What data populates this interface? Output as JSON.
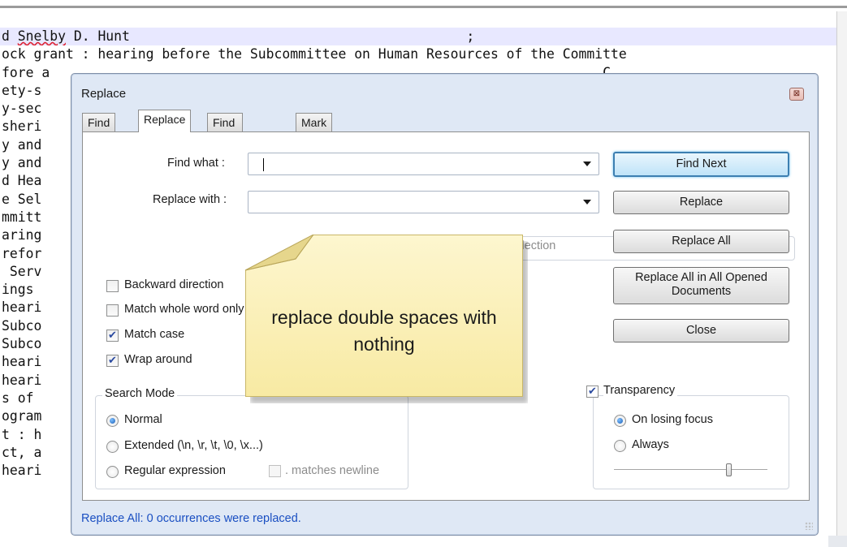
{
  "editor": {
    "lines": [
      "d Snelby D. Hunt                                          ;",
      "ock grant : hearing before the Subcommittee on Human Resources of the Committe",
      "fore a                                                                     C",
      "ety-s                                                                      or",
      "y-sec",
      "sheri                                                                      rc",
      "y and                                                                      or",
      "y and                                                                      or",
      "d Hea                                                                      Hc",
      "e Sel                                                                      s,",
      "mmitt                                                                      nc",
      "aring                                                                      e,",
      "refor                                                                      ur",
      " Serv                                                                      or",
      "ings                                                                       th",
      "heari                                                                      ur",
      "Subco                                                                      s,",
      "Subco                                                                      s,",
      "heari                                                                      ur",
      "heari                                                                      ur",
      "s of                                                                       ir",
      "ogram                                                                      es",
      "t : h                                                                      c",
      "ct, a                                                                      th",
      "heari"
    ],
    "spellcheck_word": "Snelby"
  },
  "dialog": {
    "title": "Replace",
    "close_glyph": "⊠",
    "tabs": [
      {
        "label": "Find",
        "active": false
      },
      {
        "label": "Replace",
        "active": true
      },
      {
        "label": "Find in Files",
        "active": false
      },
      {
        "label": "Mark",
        "active": false
      }
    ],
    "find_what_label": "Find what :",
    "find_what_value": "",
    "replace_with_label": "Replace with :",
    "replace_with_value": "",
    "in_selection_label": "In selection",
    "buttons": {
      "find_next": "Find Next",
      "replace": "Replace",
      "replace_all": "Replace All",
      "replace_all_opened": "Replace All in All Opened Documents",
      "close": "Close"
    },
    "options": [
      {
        "label": "Backward direction",
        "checked": false
      },
      {
        "label": "Match whole word only",
        "checked": false
      },
      {
        "label": "Match case",
        "checked": true
      },
      {
        "label": "Wrap around",
        "checked": true
      }
    ],
    "search_mode": {
      "title": "Search Mode",
      "options": [
        {
          "label": "Normal",
          "selected": true
        },
        {
          "label": "Extended (\\n, \\r, \\t, \\0, \\x...)",
          "selected": false
        },
        {
          "label": "Regular expression",
          "selected": false
        }
      ],
      "matches_newline_label": ". matches newline",
      "matches_newline_checked": false
    },
    "transparency": {
      "label": "Transparency",
      "checked": true,
      "options": [
        {
          "label": "On losing focus",
          "selected": true
        },
        {
          "label": "Always",
          "selected": false
        }
      ],
      "slider_value": 0.75
    },
    "status": "Replace All: 0 occurrences were replaced."
  },
  "annotation": {
    "text": "replace double spaces with nothing",
    "color": "#fbf0b8"
  }
}
